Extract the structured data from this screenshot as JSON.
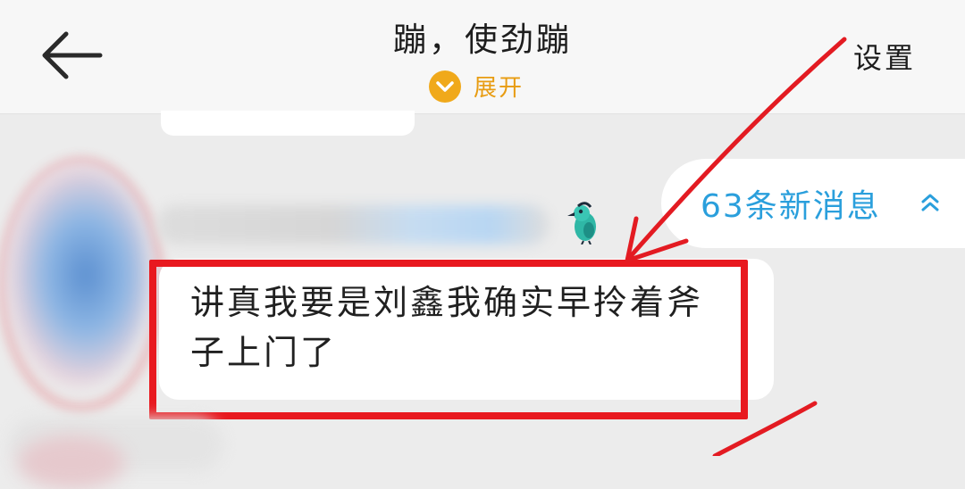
{
  "header": {
    "back_icon": "arrow-left-icon",
    "title": "蹦，使劲蹦",
    "expand_label": "展开",
    "expand_icon": "chevron-down-circle-icon",
    "settings_annotation": "设置"
  },
  "chat": {
    "message_text": "讲真我要是刘鑫我确实早拎着斧子上门了",
    "sender_badge_icon": "bird-icon",
    "new_messages": {
      "label": "63条新消息",
      "icon": "double-chevron-up-icon"
    }
  },
  "colors": {
    "accent_orange": "#f0a91b",
    "link_blue": "#2a9fdc",
    "highlight_red": "#e8191f",
    "header_bg": "#f7f7f7",
    "chat_bg": "#ececec"
  }
}
